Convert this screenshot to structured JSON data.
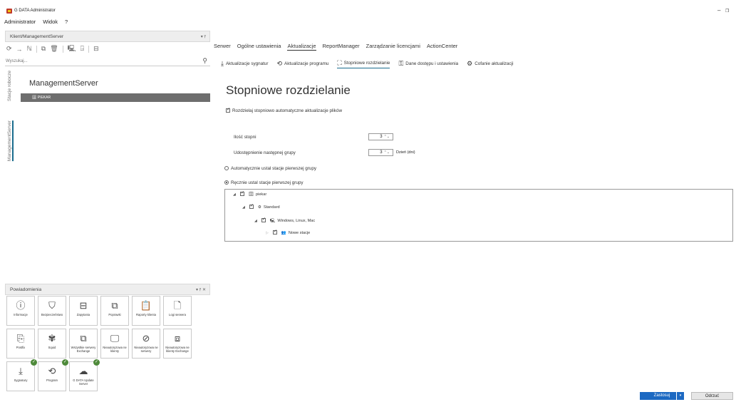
{
  "window": {
    "title": "G DATA Administrator",
    "minimize": "–",
    "restore": "❐",
    "close": "✕"
  },
  "menu": [
    "Administrator",
    "Widok",
    "?"
  ],
  "left": {
    "panel_title": "Klient/ManagementServer",
    "pin": "▾ ⫯",
    "search_placeholder": "Wyszukaj...",
    "vtabs": [
      "Stacje robocze",
      "ManagementServer"
    ],
    "tree": {
      "root": "ManagementServer",
      "item": "PIEKAR"
    },
    "notifications_title": "Powiadomienia",
    "notifications_pin": "▾ ⫯ ✕",
    "tiles": [
      {
        "label": "Informacje",
        "icon": "ⓘ"
      },
      {
        "label": "Bezpieczeństwo",
        "icon": "⛉"
      },
      {
        "label": "Zapytania",
        "icon": "⊟"
      },
      {
        "label": "Poprawki",
        "icon": "⧉"
      },
      {
        "label": "Raporty klienta",
        "icon": "📋"
      },
      {
        "label": "Logi serwera",
        "icon": "🗋"
      },
      {
        "label": "Postfix",
        "icon": "⎘"
      },
      {
        "label": "Squid",
        "icon": "✾"
      },
      {
        "label": "Wszystkie serwery Exchange",
        "icon": "⧉"
      },
      {
        "label": "Nieautoryzowa ne klienty",
        "icon": "🖵"
      },
      {
        "label": "Nieautoryzowa ne serwery",
        "icon": "⊘"
      },
      {
        "label": "Nieautoryzowa ne klienty Exchange",
        "icon": "⧈"
      },
      {
        "label": "Sygnatury",
        "icon": "⤓",
        "badge": "✓"
      },
      {
        "label": "Program",
        "icon": "⟲",
        "badge": "✓"
      },
      {
        "label": "G DATA Update Server",
        "icon": "☁",
        "badge": "✓"
      }
    ]
  },
  "right": {
    "tabs": [
      "Serwer",
      "Ogólne ustawienia",
      "Aktualizacje",
      "ReportManager",
      "Zarządzanie licencjami",
      "ActionCenter"
    ],
    "subtabs": [
      {
        "label": "Aktualizacje sygnatur",
        "icon": "⤓"
      },
      {
        "label": "Aktualizacje programu",
        "icon": "⟲"
      },
      {
        "label": "Stopniowe rozdzielanie",
        "icon": "⛶"
      },
      {
        "label": "Dane dostępu i ustawienia",
        "icon": "⚿"
      },
      {
        "label": "Cofanie aktualizacji",
        "icon": "⚙"
      }
    ],
    "page_title": "Stopniowe rozdzielanie",
    "checkbox_label": "Rozdzielaj stopniowo automatyczne aktualizacje plików",
    "steps_label": "Ilość stopni",
    "steps_value": "3",
    "next_group_label": "Udostępnienie następnej grupy",
    "next_group_value": "3",
    "next_group_unit": "Dzień (dni)",
    "auto_radio": "Automatycznie ustal stacje pierwszej grupy",
    "manual_radio": "Ręcznie ustal stacje pierwszej grupy",
    "groups": [
      "piekar",
      "Standard",
      "Windows, Linux, Mac",
      "Nowe stacje"
    ],
    "apply": "Zastosuj",
    "discard": "Odrzuć",
    "spinner": "⌃⌄"
  }
}
